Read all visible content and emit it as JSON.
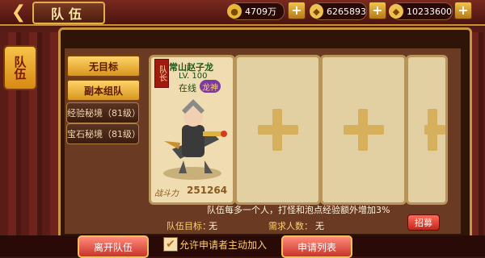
{
  "header": {
    "title": "队伍",
    "resources": [
      {
        "icon": "coin-icon",
        "value": "4709万"
      },
      {
        "icon": "ingot-icon",
        "value": "6265893"
      },
      {
        "icon": "ingot-icon",
        "value": "10233600"
      }
    ]
  },
  "side_tab": "队伍",
  "menu": [
    "无目标",
    "副本组队",
    "经验秘境（81级）",
    "宝石秘境（81级）"
  ],
  "member": {
    "tag": "队长",
    "name": "常山赵子龙",
    "level": "LV. 100",
    "status": "在线",
    "badge": "龙神",
    "power_label": "战斗力",
    "power": "251264"
  },
  "team_tip": "队伍每多一个人，打怪和泡点经验额外增加3%",
  "target_label": "队伍目标：",
  "target_value": "无",
  "req_label": "需求人数：",
  "req_value": "无",
  "recruit_button": "招募",
  "bottom": {
    "leave": "离开队伍",
    "auto_join": "允许申请者主动加入",
    "apply_list": "申请列表"
  },
  "colors": {
    "gold": "#f4c24a",
    "panel": "#e2cfa2"
  }
}
